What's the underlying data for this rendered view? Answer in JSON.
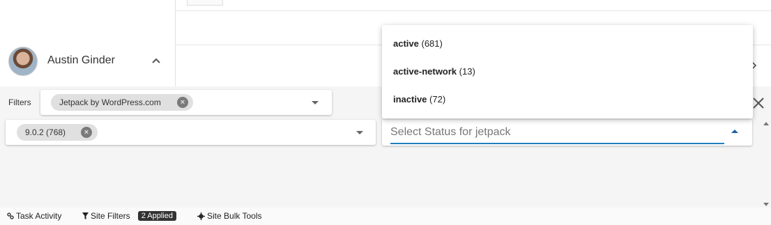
{
  "user": {
    "name": "Austin Ginder"
  },
  "filters": {
    "label": "Filters",
    "plugin_chip": "Jetpack by WordPress.com",
    "version_chip": "9.0.2 (768)",
    "status_placeholder": "Select Status for jetpack"
  },
  "status_options": [
    {
      "name": "active",
      "count": "(681)"
    },
    {
      "name": "active-network",
      "count": "(13)"
    },
    {
      "name": "inactive",
      "count": "(72)"
    }
  ],
  "toolbar": {
    "task_activity": "Task Activity",
    "site_filters": "Site Filters",
    "applied_badge": "2 Applied",
    "site_bulk_tools": "Site Bulk Tools"
  },
  "icons": {
    "avatar": "user-avatar",
    "collapse": "chevron-up-icon",
    "expand": "chevron-right-icon",
    "close": "close-icon",
    "chip_remove": "cancel-circle-icon",
    "task": "task-activity-icon",
    "filter": "filter-icon",
    "gear": "gear-icon"
  },
  "colors": {
    "focus_underline": "#1f7fbf",
    "badge_bg": "#333333",
    "chip_bg": "#e0e0e0"
  }
}
